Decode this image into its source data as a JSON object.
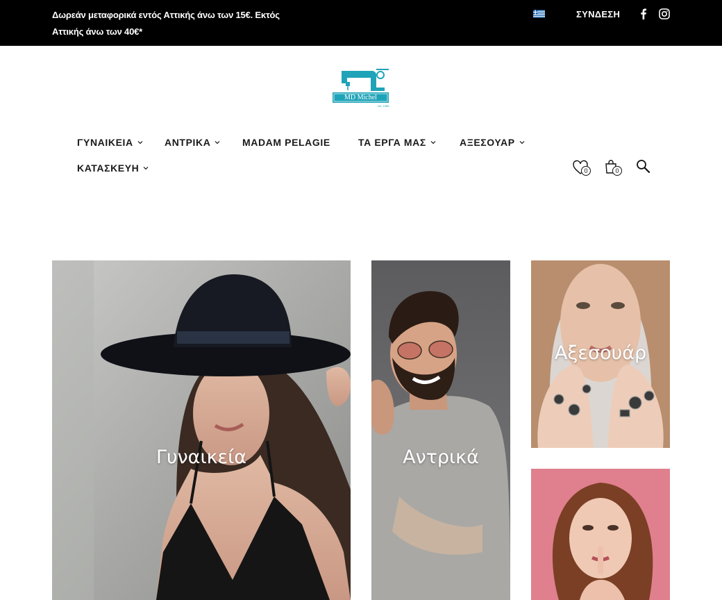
{
  "topbar": {
    "promo_line1": "Δωρεάν μεταφορικά εντός Αττικής άνω των 15€. Εκτός",
    "promo_line2": "Αττικής άνω των 40€*",
    "login_label": "ΣΥΝΔΕΣΗ",
    "language_icon": "greek-flag-icon",
    "social_icons": [
      "facebook-icon",
      "instagram-icon"
    ]
  },
  "logo": {
    "brand": "MD Michel",
    "icon": "sewing-machine-icon"
  },
  "nav": {
    "items": [
      {
        "label": "ΓΥΝΑΙΚΕΙΑ",
        "has_dropdown": true
      },
      {
        "label": "ΑΝΤΡΙΚΑ",
        "has_dropdown": true
      },
      {
        "label": "MADAM PELAGIE",
        "has_dropdown": false
      },
      {
        "label": "ΤΑ ΕΡΓΑ ΜΑΣ",
        "has_dropdown": true
      },
      {
        "label": "ΑΞΕΣΟΥΑΡ",
        "has_dropdown": true
      },
      {
        "label": "ΚΑΤΑΣΚΕΥΗ",
        "has_dropdown": true
      }
    ],
    "wishlist_count": "0",
    "cart_count": "0"
  },
  "banners": [
    {
      "label": "Γυναικεία"
    },
    {
      "label": "Αντρικά"
    },
    {
      "label": "Αξεσουάρ"
    },
    {
      "label": ""
    }
  ],
  "colors": {
    "topbar_bg": "#000000",
    "brand_teal": "#1fa3b8",
    "text_dark": "#1a1a1a"
  }
}
